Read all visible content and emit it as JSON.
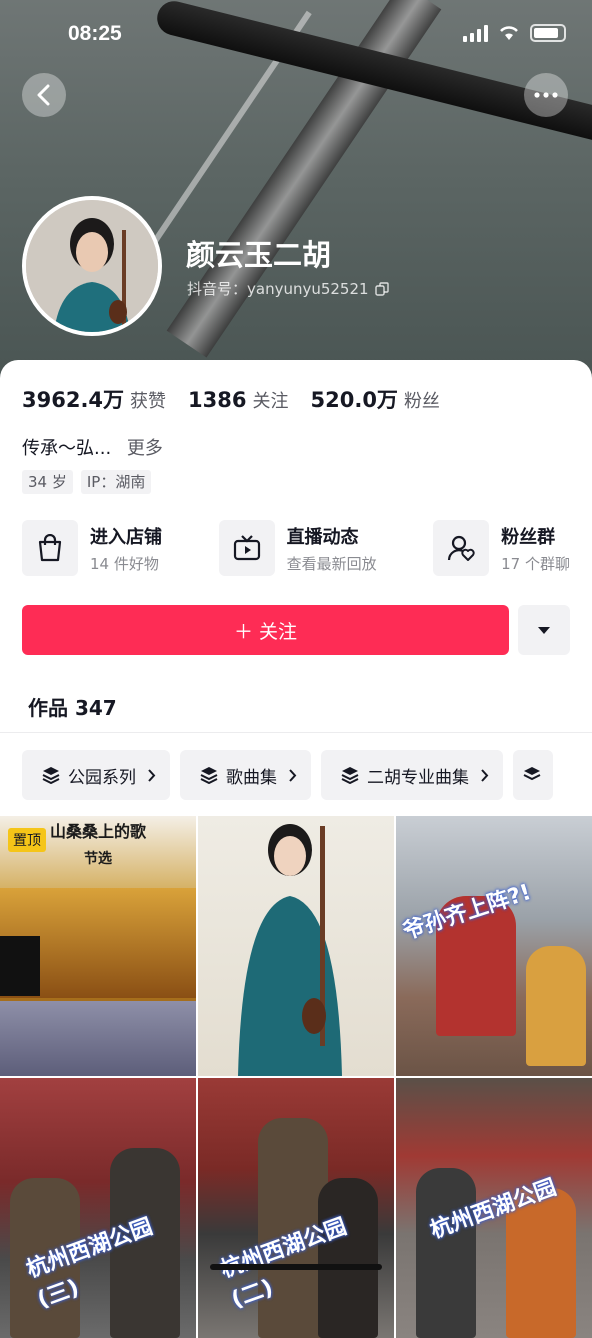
{
  "status_bar": {
    "time": "08:25"
  },
  "profile": {
    "name": "颜云玉二胡",
    "douyin_id": "抖音号：yanyunyu52521"
  },
  "stats": [
    {
      "value": "3962.4万",
      "label": "获赞"
    },
    {
      "value": "1386",
      "label": "关注"
    },
    {
      "value": "520.0万",
      "label": "粉丝"
    }
  ],
  "bio": {
    "text": "传承～弘...",
    "more": "更多"
  },
  "tags": [
    "34 岁",
    "IP：湖南"
  ],
  "features": [
    {
      "title": "进入店铺",
      "subtitle": "14 件好物",
      "icon": "shopping-bag-icon"
    },
    {
      "title": "直播动态",
      "subtitle": "查看最新回放",
      "icon": "tv-icon"
    },
    {
      "title": "粉丝群",
      "subtitle": "17 个群聊",
      "icon": "fan-group-icon"
    }
  ],
  "actions": {
    "follow_label": "＋ 关注"
  },
  "works": {
    "title": "作品 347"
  },
  "collections": [
    {
      "label": "公园系列"
    },
    {
      "label": "歌曲集"
    },
    {
      "label": "二胡专业曲集"
    }
  ],
  "videos": [
    {
      "badge": "置顶",
      "caption": "山桑桑上的歌",
      "sub": "节选"
    },
    {
      "caption": ""
    },
    {
      "caption": "爷孙齐上阵?!"
    },
    {
      "caption": "杭州西湖公园(三)"
    },
    {
      "caption": "杭州西湖公园(二)"
    },
    {
      "caption": "杭州西湖公园"
    }
  ],
  "colors": {
    "accent": "#fe2c55",
    "badge": "#f5c518"
  }
}
